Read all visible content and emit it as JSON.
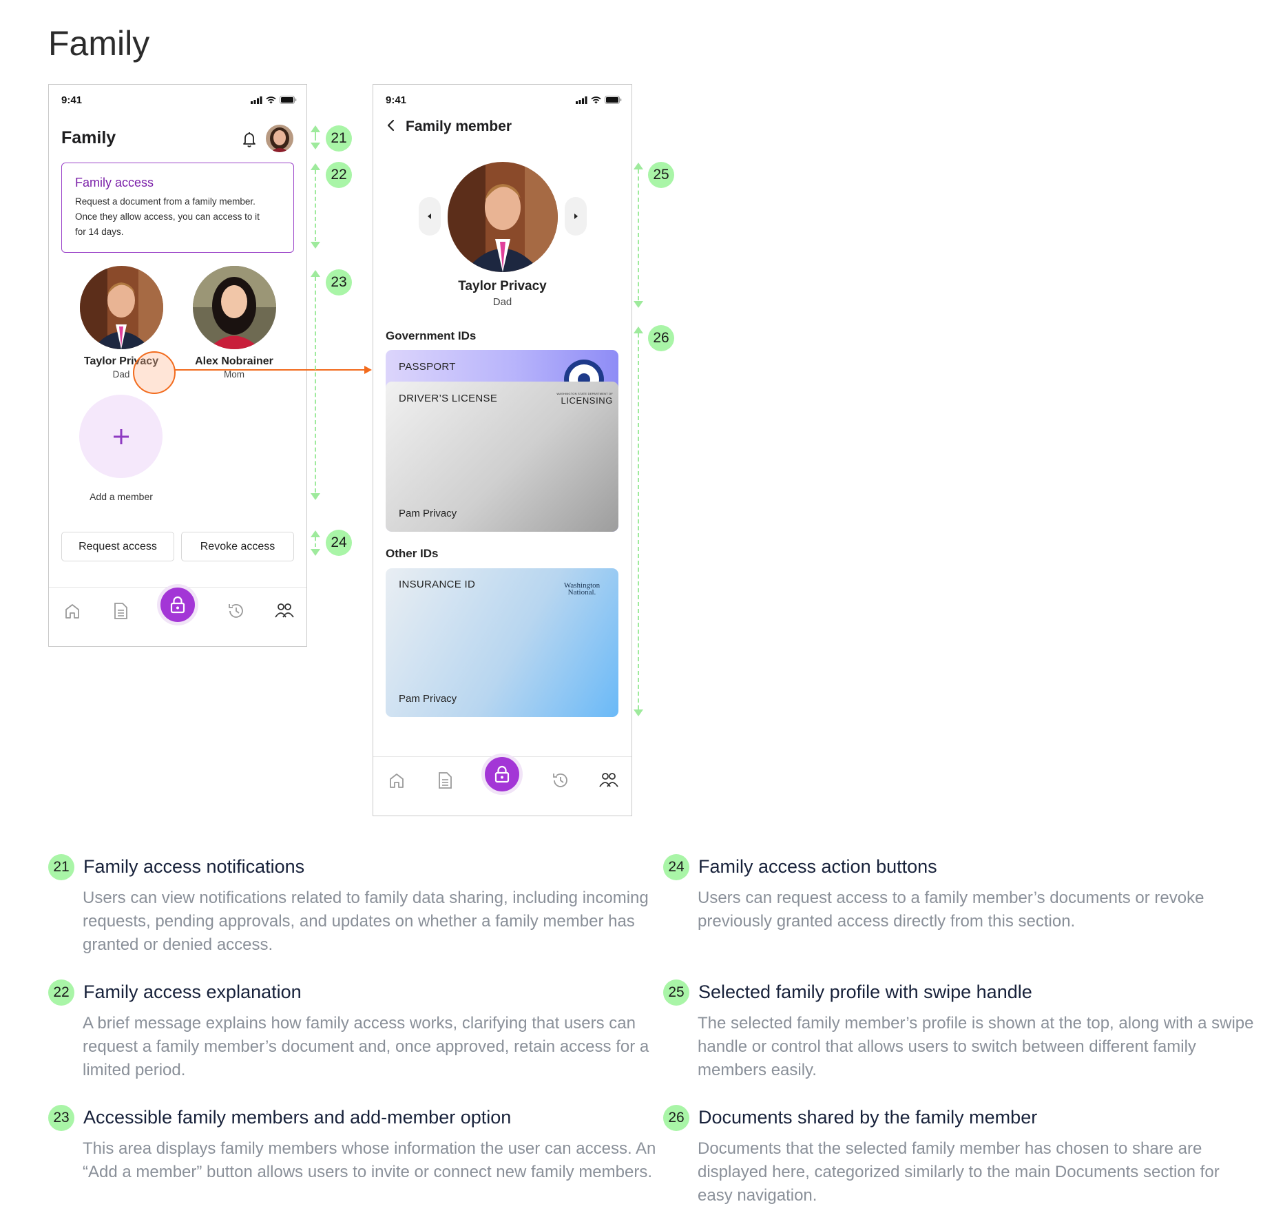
{
  "page": {
    "title": "Family"
  },
  "colors": {
    "accent": "#a336d6",
    "accent_dark": "#7a1fa8",
    "annotation_green": "#a9f5a7",
    "highlight_orange": "#f26b1d"
  },
  "screen1": {
    "status_time": "9:41",
    "header_title": "Family",
    "icons": [
      "bell-icon",
      "avatar"
    ],
    "access_card": {
      "title": "Family access",
      "body_lines": [
        "Request a document from a family member.",
        "Once they allow access, you can access to it",
        "for 14 days."
      ]
    },
    "members": [
      {
        "name": "Taylor Privacy",
        "role": "Dad"
      },
      {
        "name": "Alex Nobrainer",
        "role": "Mom"
      }
    ],
    "add_member": {
      "icon": "plus-icon",
      "label": "Add a member"
    },
    "buttons": {
      "request": "Request access",
      "revoke": "Revoke access"
    },
    "tabbar": [
      "home-icon",
      "document-icon",
      "lock-icon",
      "history-icon",
      "family-icon"
    ]
  },
  "screen2": {
    "status_time": "9:41",
    "header_title": "Family member",
    "profile": {
      "name": "Taylor Privacy",
      "role": "Dad"
    },
    "sections": {
      "government": "Government IDs",
      "other": "Other IDs"
    },
    "cards": {
      "passport": {
        "label": "PASSPORT"
      },
      "drivers_license": {
        "label": "DRIVER’S LICENSE",
        "issuer_top": "WASHINGTON STATE DEPARTMENT OF",
        "issuer": "LICENSING",
        "holder": "Pam Privacy"
      },
      "insurance": {
        "label": "INSURANCE ID",
        "issuer_line1": "Washington",
        "issuer_line2": "National.",
        "holder": "Pam Privacy"
      }
    },
    "tabbar": [
      "home-icon",
      "document-icon",
      "lock-icon",
      "history-icon",
      "family-icon"
    ]
  },
  "annotations": {
    "markers": [
      "21",
      "22",
      "23",
      "24",
      "25",
      "26"
    ]
  },
  "legend": [
    {
      "num": "21",
      "title": "Family access notifications",
      "text": "Users can view notifications related to family data sharing, including incoming requests, pending approvals, and updates on whether a family member has granted or denied access."
    },
    {
      "num": "22",
      "title": "Family access explanation",
      "text": "A brief message explains how family access works, clarifying that users can request a family member’s document and, once approved, retain access for a limited period."
    },
    {
      "num": "23",
      "title": "Accessible family members and add-member option",
      "text": "This area displays family members whose information the user can access. An “Add a member” button allows users to invite or connect new family members."
    },
    {
      "num": "24",
      "title": "Family access action buttons",
      "text": "Users can request access to a family member’s documents or revoke previously granted access directly from this section."
    },
    {
      "num": "25",
      "title": "Selected family profile with swipe handle",
      "text": "The selected family member’s profile is shown at the top, along with a swipe handle or control that allows users to switch between different family members easily."
    },
    {
      "num": "26",
      "title": "Documents shared by the family member",
      "text": "Documents that the selected family member has chosen to share are displayed here, categorized similarly to the main Documents section for easy navigation."
    }
  ]
}
